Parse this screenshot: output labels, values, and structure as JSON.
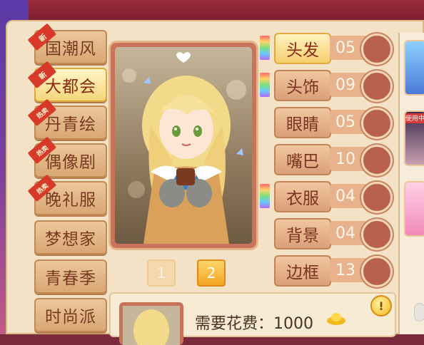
{
  "categories": [
    {
      "label": "国潮风",
      "badge": "新",
      "active": false
    },
    {
      "label": "大都会",
      "badge": "新",
      "active": true
    },
    {
      "label": "丹青绘",
      "badge": "热卖",
      "active": false
    },
    {
      "label": "偶像剧",
      "badge": "热卖",
      "active": false
    },
    {
      "label": "晚礼服",
      "badge": "热卖",
      "active": false
    },
    {
      "label": "梦想家",
      "badge": "",
      "active": false
    },
    {
      "label": "青春季",
      "badge": "",
      "active": false
    },
    {
      "label": "时尚派",
      "badge": "",
      "active": false
    }
  ],
  "features": [
    {
      "label": "头发",
      "count": "05",
      "active": true,
      "rainbow": true
    },
    {
      "label": "头饰",
      "count": "09",
      "active": false,
      "rainbow": true
    },
    {
      "label": "眼睛",
      "count": "05",
      "active": false,
      "rainbow": false
    },
    {
      "label": "嘴巴",
      "count": "10",
      "active": false,
      "rainbow": false
    },
    {
      "label": "衣服",
      "count": "04",
      "active": false,
      "rainbow": true
    },
    {
      "label": "背景",
      "count": "04",
      "active": false,
      "rainbow": false
    },
    {
      "label": "边框",
      "count": "13",
      "active": false,
      "rainbow": false
    }
  ],
  "pagination": {
    "page1": "1",
    "page2": "2",
    "current": "2"
  },
  "cost": {
    "label": "需要花费：1000"
  },
  "avatars": [
    {
      "tag": ""
    },
    {
      "tag": "使用中"
    },
    {
      "tag": ""
    }
  ],
  "info_button": "!",
  "colors": {
    "panel": "#f3e2c6",
    "active_gold": "#f5d67a",
    "button_tan": "#d8a774",
    "badge_red": "#d83a2a"
  }
}
